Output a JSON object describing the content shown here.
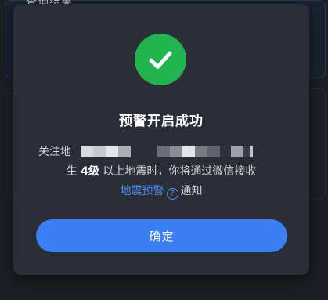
{
  "background": {
    "title": "查询结果"
  },
  "dialog": {
    "title": "预警开启成功",
    "follow_prefix": "关注地",
    "line2_pre": "生 ",
    "magnitude": "4级",
    "line2_post": " 以上地震时，你将通过微信接收",
    "link_label": "地震预警",
    "help_glyph": "?",
    "notify_suffix": "通知",
    "confirm_label": "确定"
  },
  "colors": {
    "success_green": "#21b550",
    "accent_blue": "#3a7ff3",
    "link_blue": "#4a8ff0",
    "dialog_bg": "#2b2e36"
  },
  "icons": {
    "success": "check-circle-icon",
    "help": "question-circle-icon"
  }
}
